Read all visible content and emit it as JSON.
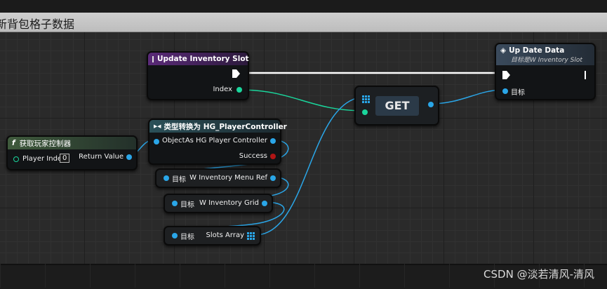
{
  "comment": {
    "title": "新背包格子数据"
  },
  "nodes": {
    "update_inventory_slot": {
      "title": "Update Inventory Slot",
      "index_label": "Index"
    },
    "get_player_controller": {
      "title": "获取玩家控制器",
      "player_index_label": "Player Index",
      "player_index_value": "0",
      "return_label": "Return Value"
    },
    "cast_to_controller": {
      "title": "类型转换为 HG_PlayerController",
      "object_label": "Object",
      "as_label": "As HG Player Controller",
      "success_label": "Success"
    },
    "get_menu_ref": {
      "target_label": "目标",
      "output_label": "W Inventory Menu Ref"
    },
    "get_inventory_grid": {
      "target_label": "目标",
      "output_label": "W Inventory Grid"
    },
    "get_slots_array": {
      "target_label": "目标",
      "output_label": "Slots Array"
    },
    "array_get": {
      "title": "GET"
    },
    "update_data": {
      "title": "Up Date Data",
      "subtitle": "目标是W Inventory Slot",
      "target_label": "目标"
    }
  },
  "watermark": "CSDN @淡若清风-清风",
  "colors": {
    "object_pin": "#2aa6e8",
    "int_pin": "#1ad69c",
    "exec_wire": "#ffffff",
    "bool_pin": "#b01515"
  },
  "icons": {
    "function": "function-icon",
    "event": "event-icon",
    "cast": "cast-icon",
    "array": "array-icon",
    "exec": "exec-pin-icon"
  }
}
